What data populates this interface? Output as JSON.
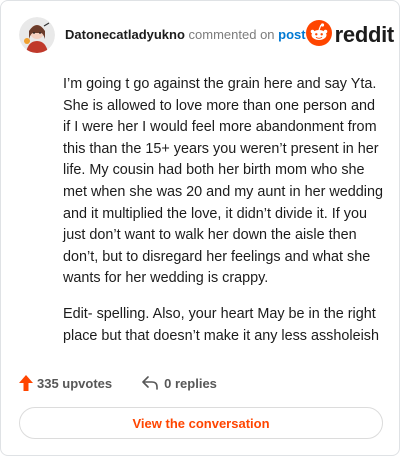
{
  "header": {
    "author": "Datonecatladyukno",
    "verb": "commented on",
    "link_text": "post",
    "brand_name": "reddit",
    "brand_color": "#ff4500"
  },
  "comment": {
    "paragraphs": [
      "I’m going t go against the grain here and say Yta. She is allowed to love more than one person and if I were her I would feel more abandonment from this than the 15+ years you weren’t present in her life. My cousin had both her birth mom who she met when she was 20 and my aunt in her wedding and it multiplied the love, it didn’t divide it. If you just don’t want to walk her down the aisle then don’t, but to disregard her feelings and what she wants for her wedding is crappy.",
      "Edit- spelling. Also, your heart May be in the right place but that doesn’t make it any less assholeish"
    ]
  },
  "stats": {
    "upvotes": "335 upvotes",
    "replies": "0 replies",
    "upvote_color": "#ff4500"
  },
  "cta": {
    "label": "View the conversation"
  },
  "icons": {
    "avatar": "avatar",
    "brand": "reddit-logo-icon",
    "upvote": "upvote-arrow-icon",
    "reply": "reply-arrow-icon"
  }
}
